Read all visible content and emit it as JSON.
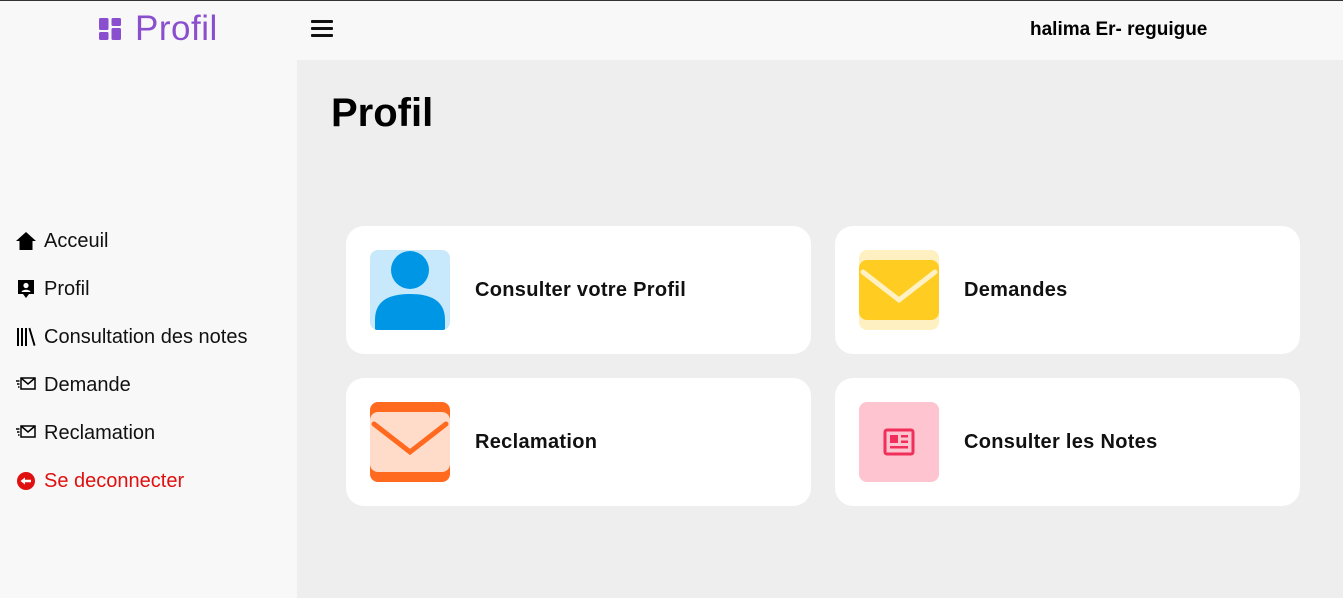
{
  "brand": {
    "title": "Profil",
    "icon": "dashboard-icon",
    "color": "#8a4fcf"
  },
  "header": {
    "menu_icon": "hamburger-icon",
    "username": "halima Er- reguigue"
  },
  "sidebar": {
    "items": [
      {
        "label": "Acceuil",
        "icon": "home-icon"
      },
      {
        "label": "Profil",
        "icon": "profile-badge-icon"
      },
      {
        "label": "Consultation des notes",
        "icon": "books-icon"
      },
      {
        "label": "Demande",
        "icon": "mail-send-icon"
      },
      {
        "label": "Reclamation",
        "icon": "mail-send-icon"
      },
      {
        "label": "Se deconnecter",
        "icon": "logout-icon",
        "color": "#e01010"
      }
    ]
  },
  "main": {
    "title": "Profil",
    "cards": [
      {
        "label": "Consulter votre Profil",
        "icon": "user-icon",
        "color": "#0096e6"
      },
      {
        "label": "Demandes",
        "icon": "envelope-icon",
        "color": "#ffcc22"
      },
      {
        "label": "Reclamation",
        "icon": "envelope-icon",
        "color": "#ff6a1f"
      },
      {
        "label": "Consulter les Notes",
        "icon": "newspaper-icon",
        "color": "#f0305a"
      }
    ]
  }
}
